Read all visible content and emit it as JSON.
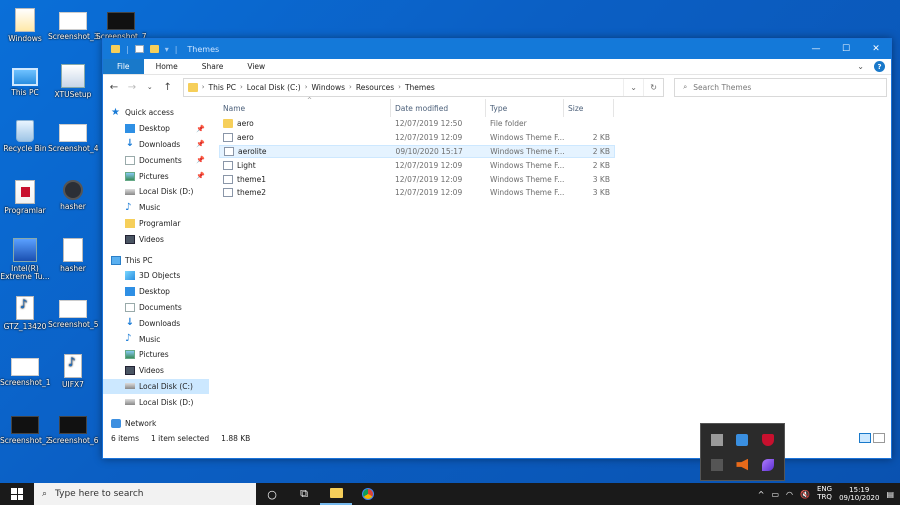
{
  "desktop": {
    "icons": [
      {
        "label": "Windows"
      },
      {
        "label": "Screenshot_3"
      },
      {
        "label": "Screenshot_7"
      },
      {
        "label": "This PC"
      },
      {
        "label": "XTUSetup"
      },
      {
        "label": "Recycle Bin"
      },
      {
        "label": "Screenshot_4"
      },
      {
        "label": "Programlar"
      },
      {
        "label": "hasher"
      },
      {
        "label": "Intel(R) Extreme Tu..."
      },
      {
        "label": "hasher"
      },
      {
        "label": "GTZ_13420"
      },
      {
        "label": "Screenshot_5"
      },
      {
        "label": "Screenshot_1"
      },
      {
        "label": "UIFX7"
      },
      {
        "label": "Screenshot_2"
      },
      {
        "label": "Screenshot_6"
      }
    ]
  },
  "window": {
    "title": "Themes",
    "ribbon_tabs": [
      "File",
      "Home",
      "Share",
      "View"
    ],
    "address": {
      "crumbs": [
        "This PC",
        "Local Disk (C:)",
        "Windows",
        "Resources",
        "Themes"
      ]
    },
    "search_placeholder": "Search Themes",
    "nav": {
      "quick_access": "Quick access",
      "quick_items": [
        {
          "label": "Desktop",
          "icon": "desktop-icon",
          "pinned": true
        },
        {
          "label": "Downloads",
          "icon": "downloads-icon",
          "pinned": true
        },
        {
          "label": "Documents",
          "icon": "documents-icon",
          "pinned": true
        },
        {
          "label": "Pictures",
          "icon": "pictures-icon",
          "pinned": true
        },
        {
          "label": "Local Disk (D:)",
          "icon": "drive-icon",
          "pinned": false
        },
        {
          "label": "Music",
          "icon": "music-icon",
          "pinned": false
        },
        {
          "label": "Programlar",
          "icon": "folder-icon",
          "pinned": false
        },
        {
          "label": "Videos",
          "icon": "videos-icon",
          "pinned": false
        }
      ],
      "this_pc": "This PC",
      "pc_items": [
        {
          "label": "3D Objects",
          "icon": "cube-icon"
        },
        {
          "label": "Desktop",
          "icon": "desktop-icon"
        },
        {
          "label": "Documents",
          "icon": "documents-icon"
        },
        {
          "label": "Downloads",
          "icon": "downloads-icon"
        },
        {
          "label": "Music",
          "icon": "music-icon"
        },
        {
          "label": "Pictures",
          "icon": "pictures-icon"
        },
        {
          "label": "Videos",
          "icon": "videos-icon"
        },
        {
          "label": "Local Disk (C:)",
          "icon": "drive-icon"
        },
        {
          "label": "Local Disk (D:)",
          "icon": "drive-icon"
        }
      ],
      "network": "Network"
    },
    "columns": [
      "Name",
      "Date modified",
      "Type",
      "Size"
    ],
    "files": [
      {
        "name": "aero",
        "date": "12/07/2019 12:50",
        "type": "File folder",
        "size": "",
        "kind": "folder"
      },
      {
        "name": "aero",
        "date": "12/07/2019 12:09",
        "type": "Windows Theme F...",
        "size": "2 KB",
        "kind": "theme"
      },
      {
        "name": "aerolite",
        "date": "09/10/2020 15:17",
        "type": "Windows Theme F...",
        "size": "2 KB",
        "kind": "theme"
      },
      {
        "name": "Light",
        "date": "12/07/2019 12:09",
        "type": "Windows Theme F...",
        "size": "2 KB",
        "kind": "theme"
      },
      {
        "name": "theme1",
        "date": "12/07/2019 12:09",
        "type": "Windows Theme F...",
        "size": "3 KB",
        "kind": "theme"
      },
      {
        "name": "theme2",
        "date": "12/07/2019 12:09",
        "type": "Windows Theme F...",
        "size": "3 KB",
        "kind": "theme"
      }
    ],
    "status": {
      "count": "6 items",
      "selected": "1 item selected",
      "size": "1.88 KB"
    }
  },
  "taskbar": {
    "search_placeholder": "Type here to search",
    "lang_top": "ENG",
    "lang_bottom": "TRQ",
    "time": "15:19",
    "date": "09/10/2020"
  },
  "colors": {
    "accent": "#1979ca",
    "titlebar": "#1479d9",
    "selection": "#cce8ff",
    "desktop": "#0b5fc4"
  }
}
